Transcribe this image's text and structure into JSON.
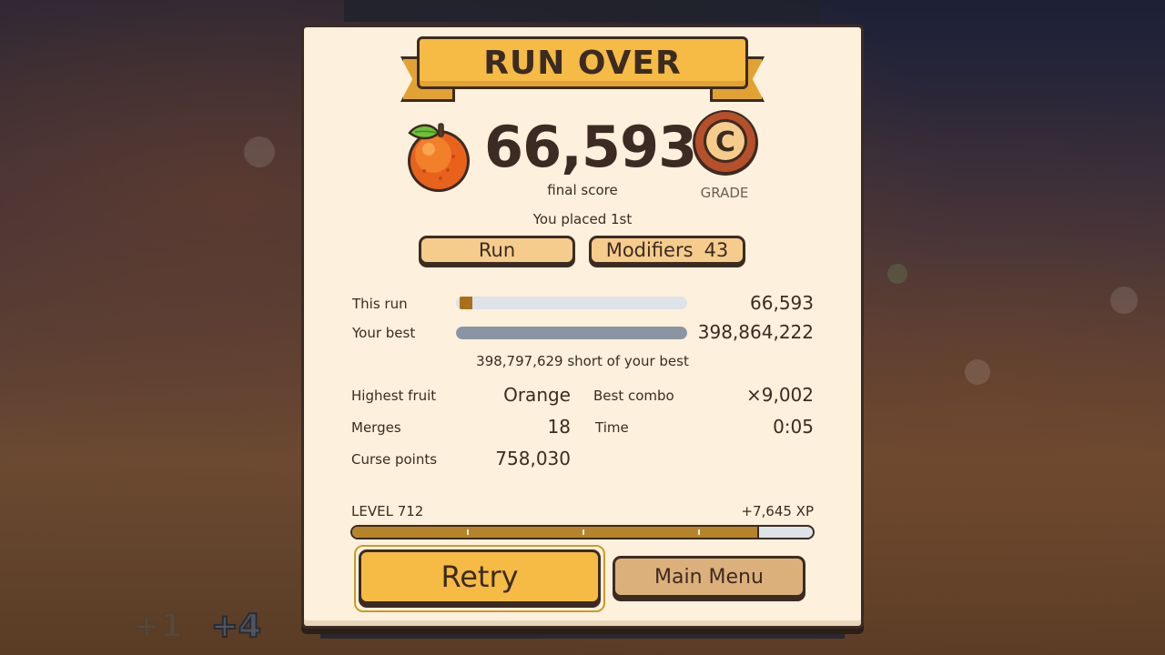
{
  "title": "RUN OVER",
  "score": {
    "value": "66,593",
    "label": "final score",
    "grade": "C",
    "grade_label": "GRADE",
    "fruit_icon": "orange-icon"
  },
  "placement": "You placed 1st",
  "tabs": {
    "run_label": "Run",
    "modifiers_label": "Modifiers",
    "modifiers_count": "43"
  },
  "comparison": {
    "this_run_label": "This run",
    "this_run_value": "66,593",
    "this_run_fraction": 0.00017,
    "best_label": "Your best",
    "best_value": "398,864,222",
    "best_fraction": 1.0,
    "short_text": "398,797,629 short of your best"
  },
  "stats": {
    "highest_fruit_label": "Highest fruit",
    "highest_fruit_value": "Orange",
    "best_combo_label": "Best combo",
    "best_combo_value": "×9,002",
    "merges_label": "Merges",
    "merges_value": "18",
    "time_label": "Time",
    "time_value": "0:05",
    "curse_label": "Curse points",
    "curse_value": "758,030"
  },
  "level": {
    "label": "LEVEL 712",
    "xp_gain": "+7,645 XP",
    "progress": 0.88
  },
  "buttons": {
    "retry_label": "Retry",
    "main_menu_label": "Main Menu"
  },
  "floating_numbers": [
    "+1",
    "+4"
  ],
  "colors": {
    "panel_bg": "#fdf0dc",
    "ribbon": "#f5bb45",
    "outline": "#3c2b22",
    "xp_fill": "#b5842a",
    "run_fill": "#a8701c",
    "best_fill": "#8a94a2",
    "track": "#dee3ea"
  }
}
